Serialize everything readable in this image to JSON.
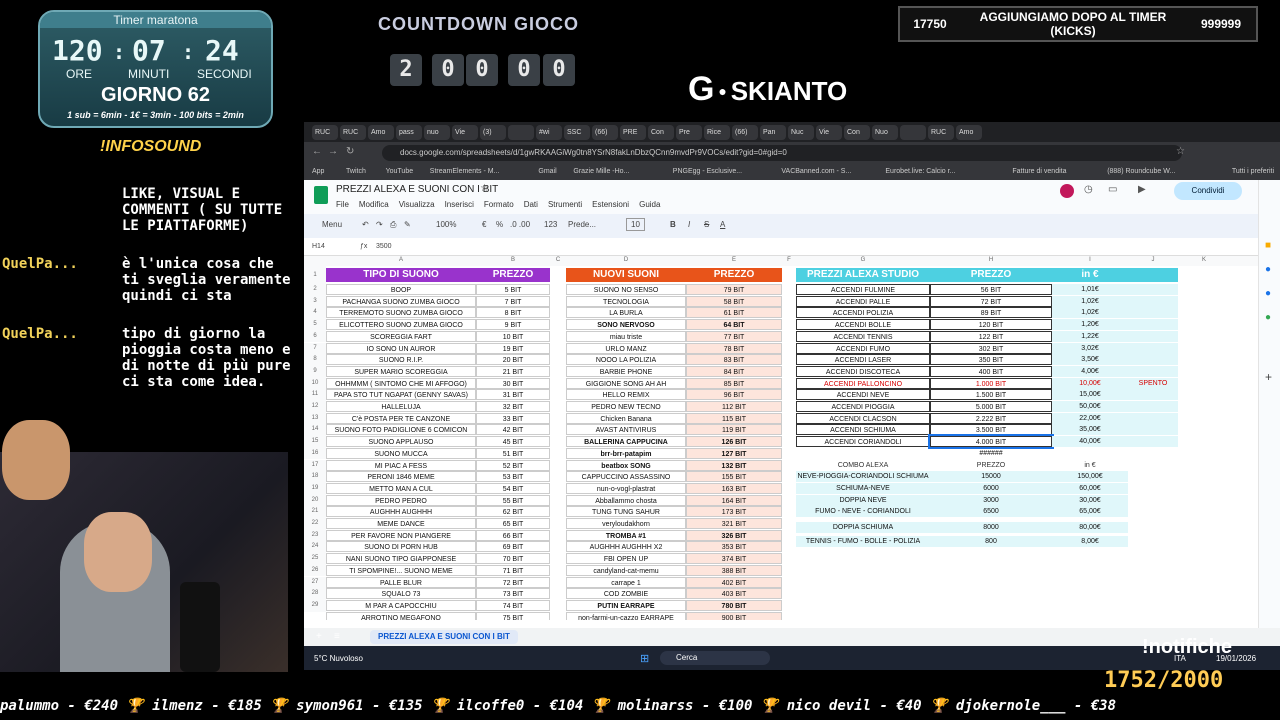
{
  "timer": {
    "title": "Timer maratona",
    "hours": "120",
    "minutes": "07",
    "seconds": "24",
    "sep": ":",
    "hours_label": "ORE",
    "minutes_label": "MINUTI",
    "seconds_label": "SECONDI",
    "day": "GIORNO 62",
    "rate": "1 sub = 6min - 1€ = 3min - 100 bits = 2min"
  },
  "infosound": "!INFOSOUND",
  "chat": {
    "intro": "LIKE, VISUAL E COMMENTI ( SU TUTTE LE PIATTAFORME)",
    "messages": [
      {
        "user": "QuelPa...",
        "text": "è l'unica cosa che ti sveglia veramente quindi ci sta"
      },
      {
        "user": "QuelPa...",
        "text": "tipo di giorno la pioggia costa meno e di notte di più pure ci sta come idea."
      }
    ]
  },
  "countdown": {
    "title": "COUNTDOWN GIOCO",
    "digits": [
      "2",
      "0",
      "0",
      "0",
      "0"
    ]
  },
  "logo": {
    "letter": "G",
    "name": "SKIANTO"
  },
  "kicks": {
    "left": "17750",
    "title": "AGGIUNGIAMO DOPO AL TIMER (KICKS)",
    "right": "999999"
  },
  "browser": {
    "tabs": [
      "RUC",
      "RUC",
      "Amo",
      "pass",
      "nuo",
      "Vie",
      "(3)",
      "",
      "#wi",
      "SSC",
      "(66)",
      "PRE",
      "Con",
      "Pre",
      "Rice",
      "(66)",
      "Pan",
      "Nuc",
      "Vie",
      "Con",
      "Nuo",
      "",
      "RUC",
      "Amo"
    ],
    "url": "docs.google.com/spreadsheets/d/1gwRKAAGiWg0tn8YSrN8fakLnDbzQCnn9mvdPr9VOCs/edit?gid=0#gid=0",
    "bookmarks": [
      "App",
      "Twitch",
      "YouTube",
      "StreamElements - M...",
      "Gmail",
      "Grazie Mille -Ho...",
      "PNGEgg - Esclusive...",
      "VACBanned.com - S...",
      "Eurobet.live: Calcio r...",
      "Fatture di vendita",
      "(888) Roundcube W..."
    ],
    "bookmarks_right": "Tutti i preferiti",
    "doc_title": "PREZZI ALEXA E SUONI CON I BIT",
    "menu": [
      "File",
      "Modifica",
      "Visualizza",
      "Inserisci",
      "Formato",
      "Dati",
      "Strumenti",
      "Estensioni",
      "Guida"
    ],
    "share": "Condividi",
    "toolbar": {
      "menus": "Menu",
      "zoom": "100%",
      "currency": "€",
      "percent": "%",
      "decimals": ".0  .00",
      "numfmt": "123",
      "font": "Prede...",
      "size": "10"
    },
    "cell_ref": "H14",
    "formula": "3500",
    "col_letters": [
      "A",
      "B",
      "C",
      "D",
      "E",
      "F",
      "G",
      "H",
      "I",
      "J",
      "K"
    ],
    "rows": [
      "1",
      "2",
      "3",
      "4",
      "5",
      "6",
      "7",
      "8",
      "9",
      "10",
      "11",
      "12",
      "13",
      "14",
      "15",
      "16",
      "17",
      "18",
      "19",
      "20",
      "21",
      "22",
      "23",
      "24",
      "25",
      "26",
      "27",
      "28",
      "29"
    ],
    "sheet_tab": "PREZZI ALEXA E SUONI CON I BIT",
    "weather": "5°C Nuvoloso",
    "search": "Cerca",
    "clock": "19/01/2026",
    "lang": "ITA"
  },
  "table1": {
    "headers": [
      "TIPO DI SUONO",
      "PREZZO"
    ],
    "rows": [
      [
        "BOOP",
        "5 BIT"
      ],
      [
        "PACHANGA SUONO ZUMBA GIOCO",
        "7 BIT"
      ],
      [
        "TERREMOTO SUONO ZUMBA GIOCO",
        "8 BIT"
      ],
      [
        "ELICOTTERO SUONO ZUMBA GIOCO",
        "9 BIT"
      ],
      [
        "SCOREGGIA FART",
        "10 BIT"
      ],
      [
        "IO SONO UN AUROR",
        "19 BIT"
      ],
      [
        "SUONO R.I.P.",
        "20 BIT"
      ],
      [
        "SUPER MARIO SCOREGGIA",
        "21 BIT"
      ],
      [
        "OHHMMM ( SINTOMO CHE MI AFFOGO)",
        "30 BIT"
      ],
      [
        "PAPA STO TUT NGAPAT (GENNY SAVAS)",
        "31 BIT"
      ],
      [
        "HALLELUJA",
        "32 BIT"
      ],
      [
        "C'è POSTA PER TE CANZONE",
        "33 BIT"
      ],
      [
        "SUONO FOTO PADIGLIONE 6 COMICON",
        "42 BIT"
      ],
      [
        "SUONO APPLAUSO",
        "45 BIT"
      ],
      [
        "SUONO MUCCA",
        "51 BIT"
      ],
      [
        "MI PIAC A FESS",
        "52 BIT"
      ],
      [
        "PERONI 1846 MEME",
        "53 BIT"
      ],
      [
        "METTO MAN A CUL",
        "54 BIT"
      ],
      [
        "PEDRO PEDRO",
        "55 BIT"
      ],
      [
        "AUGHHH AUGHHH",
        "62 BIT"
      ],
      [
        "MEME DANCE",
        "65 BIT"
      ],
      [
        "PER FAVORE NON PIANGERE",
        "66 BIT"
      ],
      [
        "SUONO DI PORN HUB",
        "69 BIT"
      ],
      [
        "NANI SUONO TIPO GIAPPONESE",
        "70 BIT"
      ],
      [
        "TI SPOMPINE!... SUONO MEME",
        "71 BIT"
      ],
      [
        "PALLE BLUR",
        "72 BIT"
      ],
      [
        "SQUALO 73",
        "73 BIT"
      ],
      [
        "M PAR A CAPOCCHIU",
        "74 BIT"
      ],
      [
        "ARROTINO MEGAFONO",
        "75 BIT"
      ]
    ]
  },
  "table2": {
    "headers": [
      "NUOVI SUONI",
      "PREZZO"
    ],
    "rows": [
      [
        "SUONO NO SENSO",
        "79 BIT"
      ],
      [
        "TECNOLOGIA",
        "58 BIT"
      ],
      [
        "LA BURLA",
        "61 BIT"
      ],
      [
        "SONO NERVOSO",
        "64 BIT"
      ],
      [
        "miau triste",
        "77 BIT"
      ],
      [
        "URLO MANZ",
        "78 BIT"
      ],
      [
        "NOOO LA POLIZIA",
        "83 BIT"
      ],
      [
        "BARBIE PHONE",
        "84 BIT"
      ],
      [
        "GIGGIONE SONG AH AH",
        "85 BIT"
      ],
      [
        "HELLO REMIX",
        "96 BIT"
      ],
      [
        "PEDRO NEW TECNO",
        "112 BIT"
      ],
      [
        "Chicken Banana",
        "115 BIT"
      ],
      [
        "AVAST ANTIVIRUS",
        "119 BIT"
      ],
      [
        "BALLERINA CAPPUCINA",
        "126 BIT"
      ],
      [
        "brr-brr-patapim",
        "127 BIT"
      ],
      [
        "beatbox SONG",
        "132 BIT"
      ],
      [
        "CAPPUCCINO ASSASSINO",
        "155 BIT"
      ],
      [
        "nun-o-vogl-plastrat",
        "163 BIT"
      ],
      [
        "Abballammo chosta",
        "164 BIT"
      ],
      [
        "TUNG TUNG SAHUR",
        "173 BIT"
      ],
      [
        "veryloudakhorn",
        "321 BIT"
      ],
      [
        "TROMBA #1",
        "326 BIT"
      ],
      [
        "AUGHHH AUGHHH X2",
        "353 BIT"
      ],
      [
        "FBI OPEN UP",
        "374 BIT"
      ],
      [
        "candyland-cat-memu",
        "388 BIT"
      ],
      [
        "carrape 1",
        "402 BIT"
      ],
      [
        "COD ZOMBIE",
        "403 BIT"
      ],
      [
        "PUTIN EARRAPE",
        "780 BIT"
      ],
      [
        "non-farmi-un-cazzo EARRAPE",
        "900 BIT"
      ]
    ]
  },
  "table3": {
    "headers": [
      "PREZZI ALEXA STUDIO",
      "PREZZO",
      "in €"
    ],
    "rows": [
      [
        "ACCENDI FULMINE",
        "56 BIT",
        "1,01€"
      ],
      [
        "ACCENDI PALLE",
        "72 BIT",
        "1,02€"
      ],
      [
        "ACCENDI POLIZIA",
        "89 BIT",
        "1,02€"
      ],
      [
        "ACCENDI BOLLE",
        "120 BIT",
        "1,20€"
      ],
      [
        "ACCENDI TENNIS",
        "122 BIT",
        "1,22€"
      ],
      [
        "ACCENDI FUMO",
        "302 BIT",
        "3,02€"
      ],
      [
        "ACCENDI LASER",
        "350 BIT",
        "3,50€"
      ],
      [
        "ACCENDI DISCOTECA",
        "400 BIT",
        "4,00€"
      ],
      [
        "ACCENDI PALLONCINO",
        "1.000 BIT",
        "10,00€"
      ],
      [
        "ACCENDI NEVE",
        "1.500 BIT",
        "15,00€"
      ],
      [
        "ACCENDI PIOGGIA",
        "5.000 BIT",
        "50,00€"
      ],
      [
        "ACCENDI CLACSON",
        "2.222 BIT",
        "22,00€"
      ],
      [
        "ACCENDI SCHIUMA",
        "3.500 BIT",
        "35,00€"
      ],
      [
        "ACCENDI CORIANDOLI",
        "4.000 BIT",
        "40,00€"
      ]
    ],
    "spento": "SPENTO",
    "hash": "######"
  },
  "table4": {
    "headers": [
      "COMBO ALEXA",
      "PREZZO",
      "in €"
    ],
    "rows": [
      [
        "NEVE-PIOGGIA-CORIANDOLI SCHIUMA",
        "15000",
        "150,00€"
      ],
      [
        "SCHIUMA-NEVE",
        "6000",
        "60,00€"
      ],
      [
        "DOPPIA NEVE",
        "3000",
        "30,00€"
      ],
      [
        "FUMO - NEVE - CORIANDOLI",
        "6500",
        "65,00€"
      ],
      [
        "DOPPIA SCHIUMA",
        "8000",
        "80,00€"
      ],
      [
        "TENNIS - FUMO - BOLLE - POLIZIA",
        "800",
        "8,00€"
      ]
    ]
  },
  "ticker": "palummo - €240  🏆 ilmenz - €185  🏆 symon961 - €135  🏆 ilcoffe0 - €104  🏆 molinarss - €100  🏆 nico devil - €40  🏆 djokernole___ - €38",
  "goal": "1752/2000",
  "notifiche": "!notifiche",
  "colors": {
    "purple": "#9933cc",
    "orange": "#e8541a",
    "cyan": "#4dd0e1",
    "red": "#d50000",
    "peach": "#fde5dc"
  }
}
